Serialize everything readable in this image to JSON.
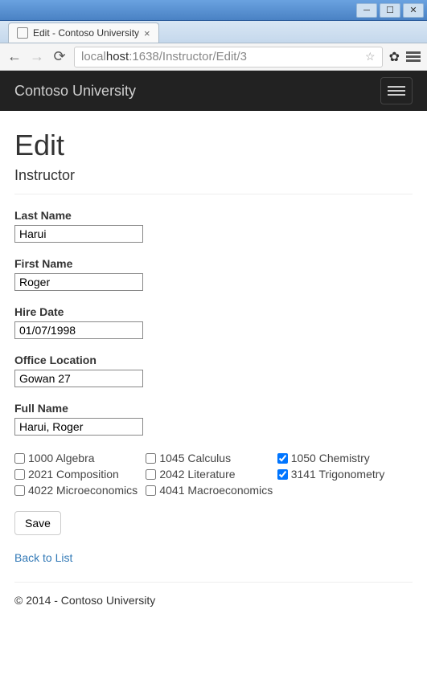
{
  "window": {
    "tab_title": "Edit - Contoso University",
    "url_pre": "local",
    "url_host": "host",
    "url_post": ":1638/Instructor/Edit/3"
  },
  "navbar": {
    "brand": "Contoso University"
  },
  "page": {
    "heading": "Edit",
    "subheading": "Instructor"
  },
  "form": {
    "last_name": {
      "label": "Last Name",
      "value": "Harui"
    },
    "first_name": {
      "label": "First Name",
      "value": "Roger"
    },
    "hire_date": {
      "label": "Hire Date",
      "value": "01/07/1998"
    },
    "office": {
      "label": "Office Location",
      "value": "Gowan 27"
    },
    "full_name": {
      "label": "Full Name",
      "value": "Harui, Roger"
    }
  },
  "courses": [
    {
      "label": "1000 Algebra",
      "checked": false
    },
    {
      "label": "1045 Calculus",
      "checked": false
    },
    {
      "label": "1050 Chemistry",
      "checked": true
    },
    {
      "label": "2021 Composition",
      "checked": false
    },
    {
      "label": "2042 Literature",
      "checked": false
    },
    {
      "label": "3141 Trigonometry",
      "checked": true
    },
    {
      "label": "4022 Microeconomics",
      "checked": false
    },
    {
      "label": "4041 Macroeconomics",
      "checked": false
    }
  ],
  "actions": {
    "save": "Save",
    "back": "Back to List"
  },
  "footer": "© 2014 - Contoso University"
}
